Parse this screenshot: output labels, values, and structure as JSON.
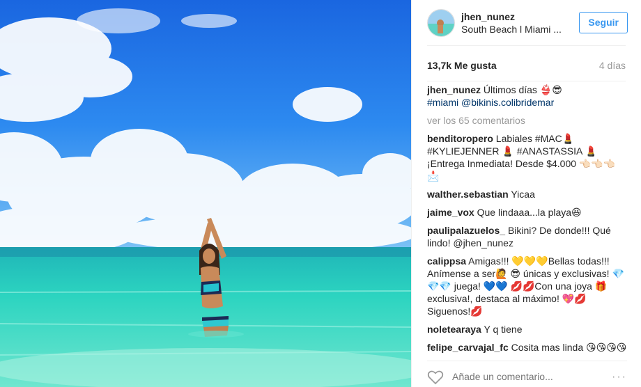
{
  "post": {
    "username": "jhen_nunez",
    "location": "South Beach l Miami ...",
    "follow_label": "Seguir",
    "likes": "13,7k Me gusta",
    "time_ago": "4 días",
    "caption_text": "Últimos días 👙😎",
    "caption_tags": "#miami @bikinis.colibridemar",
    "view_comments": "ver los 65 comentarios",
    "add_comment_placeholder": "Añade un comentario...",
    "more_icon": "···"
  },
  "comments": [
    {
      "user": "benditoropero",
      "text": "Labiales #MAC💄 #KYLIEJENNER 💄 #ANASTASSIA 💄 ¡Entrega Inmediata! Desde $4.000 👈🏻👈🏻👈🏻📩"
    },
    {
      "user": "walther.sebastian",
      "text": "Yicaa"
    },
    {
      "user": "jaime_vox",
      "text": "Que lindaaa...la playa😆"
    },
    {
      "user": "paulipalazuelos_",
      "text": "Bikini? De donde!!! Qué lindo! @jhen_nunez"
    },
    {
      "user": "calippsa",
      "text": "Amigas!!! 💛💛💛Bellas todas!!! Anímense a ser🙋 😎 únicas y exclusivas! 💎💎💎 juega! 💙💙 💋💋Con una joya 🎁 exclusiva!, destaca al máximo! 💖💋 Siguenos!💋"
    },
    {
      "user": "noletearaya",
      "text": "Y q tiene"
    },
    {
      "user": "felipe_carvajal_fc",
      "text": "Cosita mas linda 😘😘😘😘"
    }
  ],
  "colors": {
    "accent": "#3897f0",
    "hashtag": "#003569",
    "muted": "#999999",
    "sky": "#1e78e6",
    "water": "#2fd3c3"
  },
  "icons": {
    "heart": "heart-outline-icon",
    "more": "more-options-icon"
  }
}
